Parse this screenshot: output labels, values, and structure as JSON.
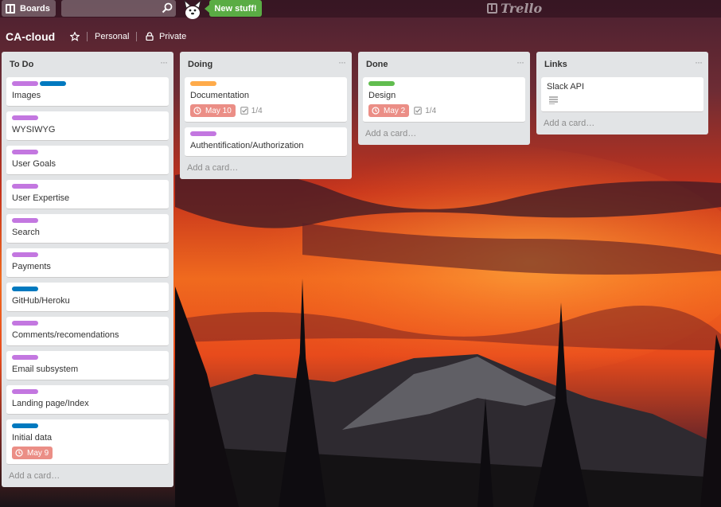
{
  "header": {
    "boards_label": "Boards",
    "search": {
      "value": "",
      "placeholder": ""
    },
    "new_stuff_label": "New stuff!",
    "logo_text": "Trello"
  },
  "board": {
    "title": "CA-cloud",
    "team": "Personal",
    "visibility": "Private"
  },
  "label_colors": {
    "purple": "#c377e0",
    "blue": "#0079bf",
    "orange": "#ffab4a",
    "green": "#61bd4f"
  },
  "lists": [
    {
      "title": "To Do",
      "menu": "···",
      "add_card": "Add a card…",
      "cards": [
        {
          "title": "Images",
          "labels": [
            "purple",
            "blue"
          ]
        },
        {
          "title": "WYSIWYG",
          "labels": [
            "purple"
          ]
        },
        {
          "title": "User Goals",
          "labels": [
            "purple"
          ]
        },
        {
          "title": "User Expertise",
          "labels": [
            "purple"
          ]
        },
        {
          "title": "Search",
          "labels": [
            "purple"
          ]
        },
        {
          "title": "Payments",
          "labels": [
            "purple"
          ]
        },
        {
          "title": "GitHub/Heroku",
          "labels": [
            "blue"
          ]
        },
        {
          "title": "Comments/recomendations",
          "labels": [
            "purple"
          ]
        },
        {
          "title": "Email subsystem",
          "labels": [
            "purple"
          ]
        },
        {
          "title": "Landing page/Index",
          "labels": [
            "purple"
          ]
        },
        {
          "title": "Initial data",
          "labels": [
            "blue"
          ],
          "due": "May 9"
        }
      ]
    },
    {
      "title": "Doing",
      "menu": "···",
      "add_card": "Add a card…",
      "cards": [
        {
          "title": "Documentation",
          "labels": [
            "orange"
          ],
          "due": "May 10",
          "checklist": "1/4"
        },
        {
          "title": "Authentification/Authorization",
          "labels": [
            "purple"
          ]
        }
      ]
    },
    {
      "title": "Done",
      "menu": "···",
      "add_card": "Add a card…",
      "cards": [
        {
          "title": "Design",
          "labels": [
            "green"
          ],
          "due": "May 2",
          "checklist": "1/4"
        }
      ]
    },
    {
      "title": "Links",
      "menu": "···",
      "add_card": "Add a card…",
      "cards": [
        {
          "title": "Slack API",
          "labels": [],
          "description_icon": "description-icon"
        }
      ]
    }
  ]
}
